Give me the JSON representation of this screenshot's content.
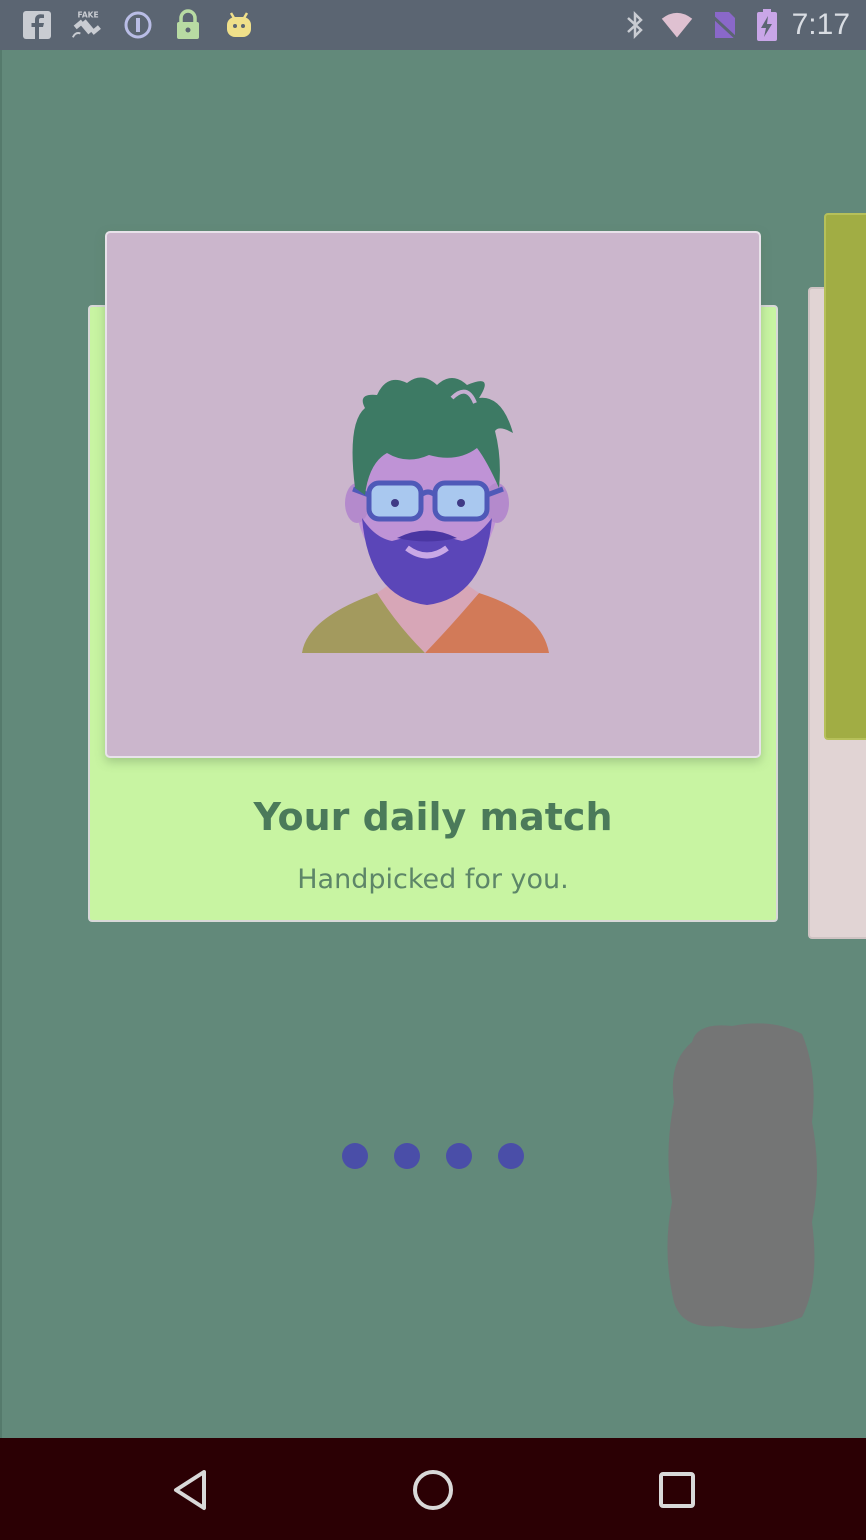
{
  "status_bar": {
    "time": "7:17",
    "left_icons": [
      "facebook-icon",
      "fake-gps-icon",
      "info-icon",
      "lock-icon",
      "android-icon"
    ],
    "right_icons": [
      "bluetooth-icon",
      "wifi-icon",
      "no-sim-icon",
      "battery-charging-icon"
    ]
  },
  "card": {
    "title": "Your daily match",
    "subtitle": "Handpicked for you.",
    "illustration": "bearded-man-with-glasses-illustration"
  },
  "pager": {
    "count": 4,
    "active_index": 0
  },
  "nav_bar": {
    "buttons": [
      "back-icon",
      "home-icon",
      "recents-icon"
    ]
  },
  "colors": {
    "background": "#62897a",
    "card_back": "#c8f4a2",
    "card_image": "#cbb6cc",
    "title_text": "#4b7a5a",
    "dot": "#4a4ea8",
    "peek_front": "#a1ad44",
    "navbar": "#2b0004"
  }
}
